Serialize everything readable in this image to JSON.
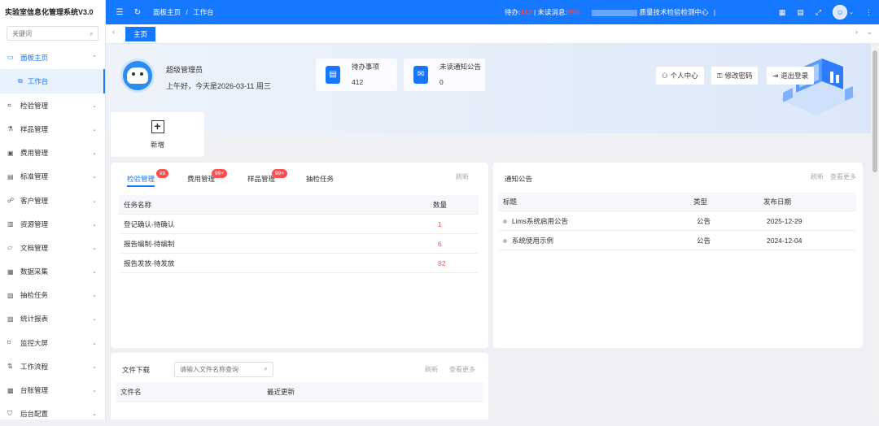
{
  "app": {
    "title": "实验室信息化管理系统V3.0"
  },
  "sidebar": {
    "search_placeholder": "关键词",
    "items": [
      {
        "label": "面板主页",
        "icon": "monitor-icon",
        "glyph": "▭",
        "expanded": true,
        "active": true
      },
      {
        "label": "工作台",
        "icon": "workbench-icon",
        "glyph": "⧉",
        "sub": true
      },
      {
        "label": "检验管理",
        "icon": "scan-icon",
        "glyph": "⌗"
      },
      {
        "label": "样品管理",
        "icon": "flask-icon",
        "glyph": "⚗"
      },
      {
        "label": "费用管理",
        "icon": "wallet-icon",
        "glyph": "▣"
      },
      {
        "label": "标准管理",
        "icon": "standard-icon",
        "glyph": "▤"
      },
      {
        "label": "客户管理",
        "icon": "customer-icon",
        "glyph": "☍"
      },
      {
        "label": "资源管理",
        "icon": "resource-icon",
        "glyph": "▥"
      },
      {
        "label": "文档管理",
        "icon": "folder-icon",
        "glyph": "▱"
      },
      {
        "label": "数据采集",
        "icon": "data-collect-icon",
        "glyph": "▦"
      },
      {
        "label": "抽检任务",
        "icon": "task-icon",
        "glyph": "▧"
      },
      {
        "label": "统计报表",
        "icon": "bar-chart-icon",
        "glyph": "▨"
      },
      {
        "label": "监控大屏",
        "icon": "screen-icon",
        "glyph": "⌑"
      },
      {
        "label": "工作流程",
        "icon": "workflow-icon",
        "glyph": "⇅"
      },
      {
        "label": "台账管理",
        "icon": "ledger-icon",
        "glyph": "▩"
      },
      {
        "label": "后台配置",
        "icon": "shield-icon",
        "glyph": "⛉"
      }
    ]
  },
  "topbar": {
    "breadcrumb": [
      "面板主页",
      "/",
      "工作台"
    ],
    "todo_label": "待办:",
    "todo_count": "412",
    "unread_label": "未读消息:",
    "unread_count": "950",
    "org_name": "质量技术检验检测中心",
    "separator": "|"
  },
  "tags": {
    "home": "主页"
  },
  "hero": {
    "user_name": "超级管理员",
    "greeting": "上午好，今天是2026-03-11 周三",
    "stats": [
      {
        "label": "待办事项",
        "value": "412"
      },
      {
        "label": "未读通知公告",
        "value": "0"
      }
    ],
    "buttons": {
      "profile": "个人中心",
      "password": "修改密码",
      "logout": "退出登录"
    }
  },
  "quick": {
    "new_label": "新增"
  },
  "tasks": {
    "tabs": [
      {
        "label": "检验管理",
        "badge": "89"
      },
      {
        "label": "费用管理",
        "badge": "99+"
      },
      {
        "label": "样品管理",
        "badge": "99+"
      },
      {
        "label": "抽检任务",
        "badge": ""
      }
    ],
    "refresh": "刷新",
    "columns": [
      "任务名称",
      "数量"
    ],
    "rows": [
      {
        "name": "登记确认-待确认",
        "count": "1"
      },
      {
        "name": "报告编制-待编制",
        "count": "6"
      },
      {
        "name": "报告发放-待发放",
        "count": "82"
      }
    ]
  },
  "notices": {
    "title": "通知公告",
    "refresh": "刷新",
    "more": "查看更多",
    "columns": [
      "标题",
      "类型",
      "发布日期"
    ],
    "rows": [
      {
        "title": "Lims系统启用公告",
        "type": "公告",
        "date": "2025-12-29"
      },
      {
        "title": "系统使用示例",
        "type": "公告",
        "date": "2024-12-04"
      }
    ]
  },
  "files": {
    "title": "文件下载",
    "search_placeholder": "请输入文件名称查询",
    "refresh": "刷新",
    "more": "查看更多",
    "columns": [
      "文件名",
      "最近更新"
    ]
  },
  "colors": {
    "primary": "#1677ff",
    "danger": "#ff4d4f"
  }
}
